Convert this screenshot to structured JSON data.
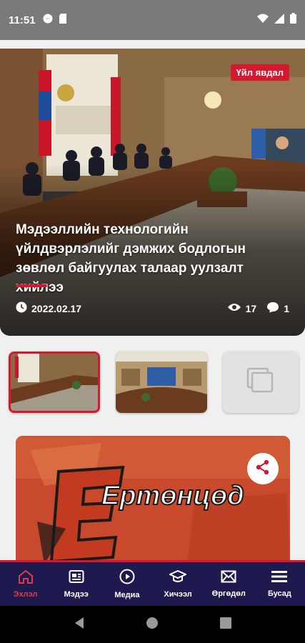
{
  "status_bar": {
    "time": "11:51",
    "left_icons": [
      "fb-messenger-icon",
      "sd-card-icon"
    ],
    "right_icons": [
      "wifi-icon",
      "signal-icon",
      "battery-icon"
    ]
  },
  "hero": {
    "badge": "Үйл явдал",
    "title": "Мэдээллийн технологийн үйлдвэрлэлийг дэмжих бодлогын зөвлөл байгуулах талаар уулзалт хийлээ",
    "date": "2022.02.17",
    "views": "17",
    "comments": "1"
  },
  "thumbnails": [
    {
      "kind": "meeting-photo",
      "active": true
    },
    {
      "kind": "meeting-photo",
      "active": false
    },
    {
      "kind": "placeholder",
      "active": false
    }
  ],
  "feature": {
    "logo_text": "Ертөнцөд"
  },
  "bottom_nav": [
    {
      "label": "Эхлэл",
      "icon": "home-icon",
      "active": true
    },
    {
      "label": "Мэдээ",
      "icon": "news-icon",
      "active": false
    },
    {
      "label": "Медиа",
      "icon": "play-icon",
      "active": false
    },
    {
      "label": "Хичээл",
      "icon": "graduation-cap-icon",
      "active": false
    },
    {
      "label": "Өргөдөл",
      "icon": "mail-icon",
      "active": false
    },
    {
      "label": "Бусад",
      "icon": "menu-icon",
      "active": false
    }
  ],
  "colors": {
    "accent": "#d6182e",
    "nav_bg": "#1e1a4f",
    "status_bar": "#7a7a7a"
  }
}
